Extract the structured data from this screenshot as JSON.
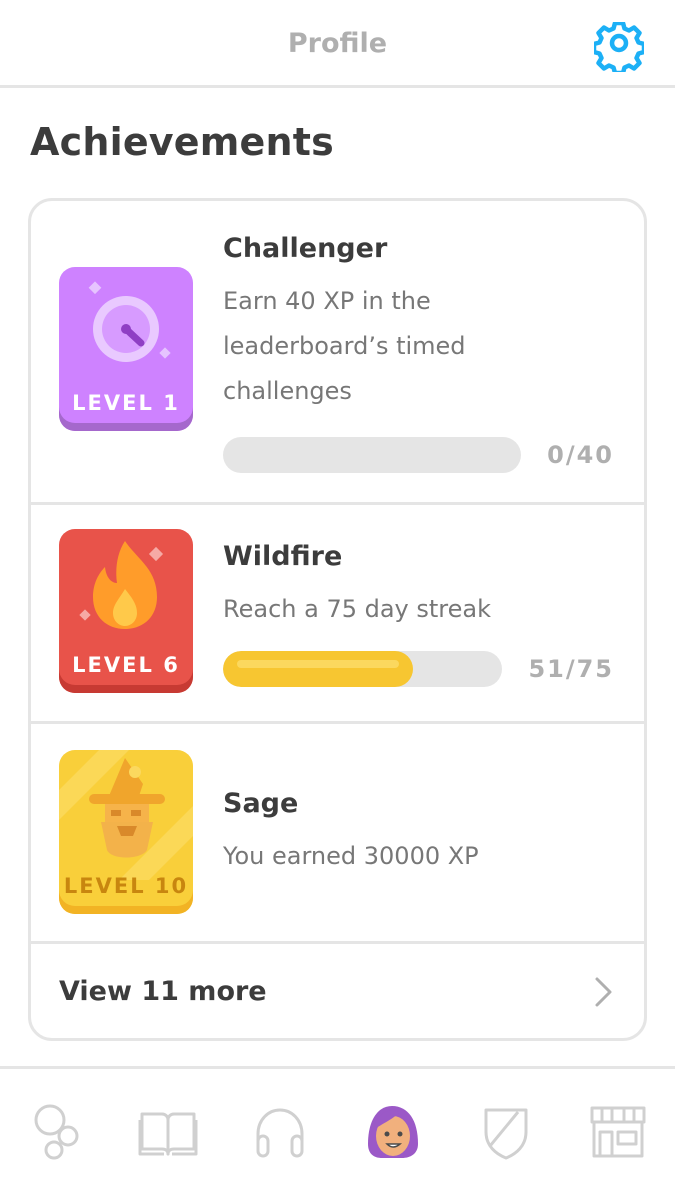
{
  "header": {
    "title": "Profile",
    "settings_icon": "gear-icon"
  },
  "section": {
    "title": "Achievements"
  },
  "achievements": [
    {
      "title": "Challenger",
      "description": "Earn 40 XP in the leaderboard’s timed challenges",
      "level": "LEVEL 1",
      "progress_text": "0/40",
      "progress": 0,
      "icon": "stopwatch-icon",
      "color": "#ce82ff"
    },
    {
      "title": "Wildfire",
      "description": "Reach a 75 day streak",
      "level": "LEVEL 6",
      "progress_text": "51/75",
      "progress": 0.68,
      "icon": "flame-icon",
      "color": "#e8534a"
    },
    {
      "title": "Sage",
      "description": "You earned 30000 XP",
      "level": "LEVEL 10",
      "icon": "sage-icon",
      "color": "#f9cf3a"
    }
  ],
  "view_more": {
    "label": "View 11 more",
    "icon": "chevron-right-icon"
  },
  "bottom_nav": [
    {
      "name": "learn",
      "icon": "bubbles-icon"
    },
    {
      "name": "stories",
      "icon": "book-icon"
    },
    {
      "name": "listening",
      "icon": "headphones-icon"
    },
    {
      "name": "profile",
      "icon": "avatar-icon",
      "active": true
    },
    {
      "name": "leagues",
      "icon": "shield-icon"
    },
    {
      "name": "shop",
      "icon": "shop-icon"
    }
  ],
  "colors": {
    "progress": "#f7c631",
    "track": "#e5e5e5",
    "accent": "#1cb0f6"
  }
}
